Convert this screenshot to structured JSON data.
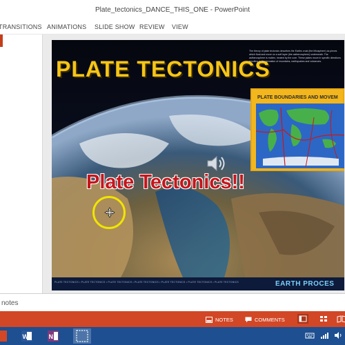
{
  "window": {
    "title": "Plate_tectonics_DANCE_THIS_ONE - PowerPoint"
  },
  "ribbon": {
    "tabs": [
      {
        "label": "TRANSITIONS"
      },
      {
        "label": "ANIMATIONS"
      },
      {
        "label": "SLIDE SHOW"
      },
      {
        "label": "REVIEW"
      },
      {
        "label": "VIEW"
      }
    ]
  },
  "slide": {
    "heading": "PLATE TECTONICS",
    "overlay_title": "Plate Tectonics!!",
    "map_title": "PLATE BOUNDARIES AND MOVEM",
    "description": "The theory of plate tectonics describes the Earths crust (the lithosphere) as pieces which float and move on a soft layer (the asthenosphere) underneath. The asthenosphere is molten, heated by the core. These plates move in specific directions resulting in the formation of mountains, earthquakes and volcanoes.",
    "footer_text": "PLATE TECTONICS • PLATE TECTONICS • PLATE TECTONICS • PLATE TECTONICS • PLATE TECTONICS • PLATE TECTONICS • PLATE TECTONICS",
    "logo_text": "EARTH PROCES"
  },
  "notes_pane": {
    "hint": "notes"
  },
  "statusbar": {
    "notes_label": "NOTES",
    "comments_label": "COMMENTS"
  },
  "colors": {
    "accent": "#d24726",
    "taskbar": "#1d4f91",
    "heading": "#f5c518",
    "overlay_title": "#c4161c"
  },
  "icons": [
    "notes-icon",
    "comments-icon",
    "normal-view-icon",
    "slide-sorter-icon",
    "reading-view-icon",
    "speaker-icon",
    "word-icon",
    "onenote-icon"
  ]
}
